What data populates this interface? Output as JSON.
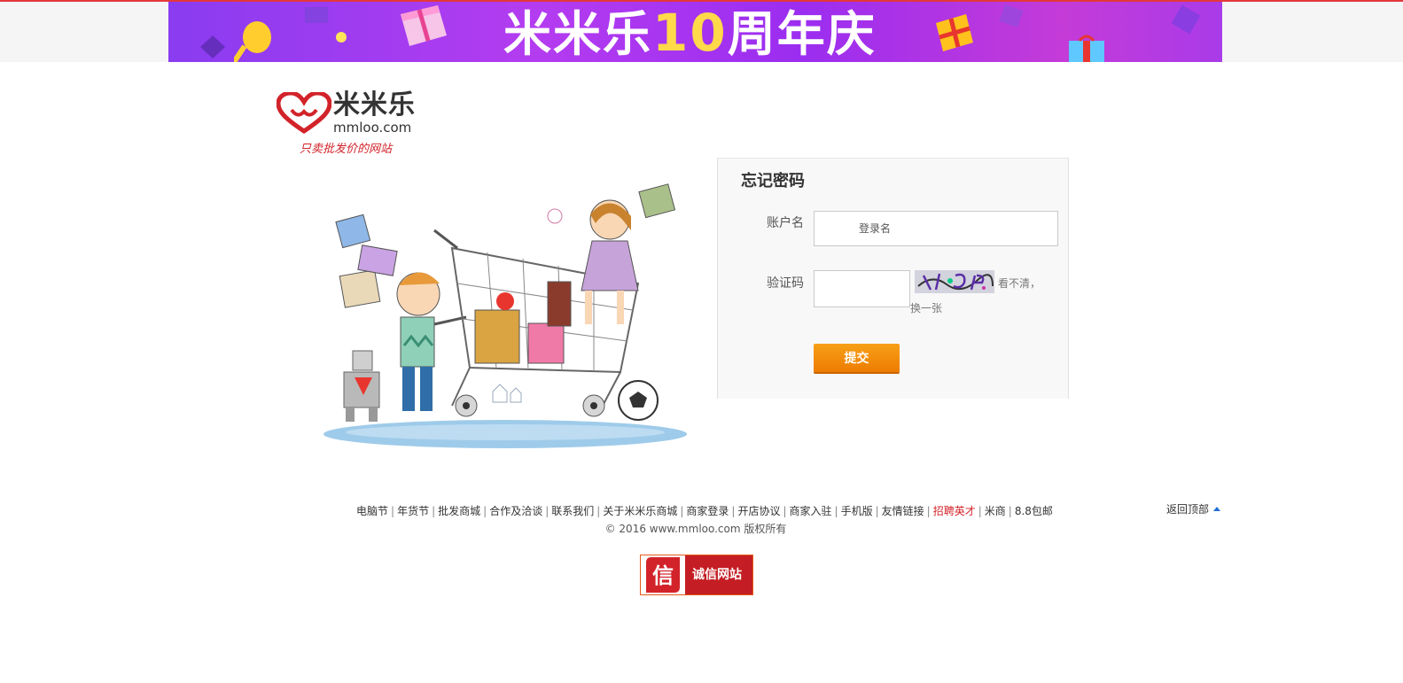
{
  "banner": {
    "title_prefix": "米米乐",
    "title_number": "10",
    "title_suffix": "周年庆"
  },
  "logo": {
    "brand_cn": "米米乐",
    "brand_en": "mmloo.com",
    "slogan": "只卖批发价的网站"
  },
  "form": {
    "title": "忘记密码",
    "account_label": "账户名",
    "account_placeholder": "登录名",
    "captcha_label": "验证码",
    "captcha_value": "",
    "refresh_text_1": "看不清，",
    "refresh_text_2": "换一张",
    "submit_label": "提交"
  },
  "footer": {
    "links": [
      "电脑节",
      "年货节",
      "批发商城",
      "合作及洽谈",
      "联系我们",
      "关于米米乐商城",
      "商家登录",
      "开店协议",
      "商家入驻",
      "手机版",
      "友情链接",
      "招聘英才",
      "米商",
      "8.8包邮"
    ],
    "highlight_link": "招聘英才",
    "copyright": "© 2016 www.mmloo.com 版权所有",
    "back_to_top": "返回顶部",
    "trust_badge_icon": "信",
    "trust_badge_text": "诚信网站"
  },
  "colors": {
    "accent_red": "#d2232a",
    "submit_orange": "#f08a0c",
    "banner_purple": "#9b2df0"
  }
}
